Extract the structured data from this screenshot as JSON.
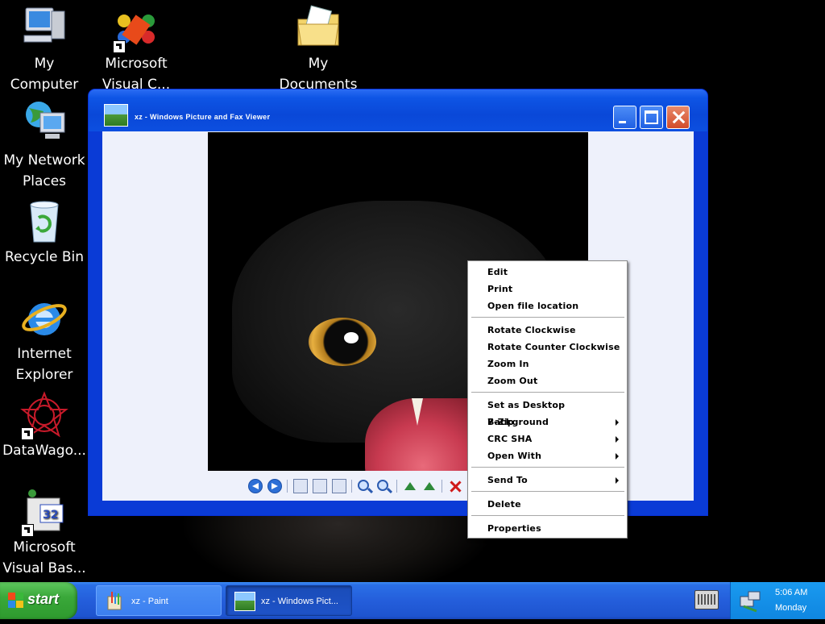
{
  "desktop": {
    "icons": [
      {
        "label_lines": [
          "My",
          "Computer"
        ]
      },
      {
        "label_lines": [
          "Microsoft",
          "Visual C..."
        ]
      },
      {
        "label_lines": [
          "My",
          "Documents"
        ]
      },
      {
        "label_lines": [
          "My Network",
          "Places"
        ]
      },
      {
        "label_lines": [
          "Recycle Bin"
        ]
      },
      {
        "label_lines": [
          "Internet",
          "Explorer"
        ]
      },
      {
        "label_lines": [
          "DataWago..."
        ]
      },
      {
        "label_lines": [
          "Microsoft",
          "Visual Bas..."
        ]
      }
    ]
  },
  "window": {
    "title": "xz - Windows Picture and Fax Viewer"
  },
  "context_menu": {
    "items": [
      {
        "label": "Edit"
      },
      {
        "label": "Print"
      },
      {
        "label": "Open file location"
      },
      {
        "label": "Rotate Clockwise"
      },
      {
        "label": "Rotate Counter Clockwise"
      },
      {
        "label": "Zoom In"
      },
      {
        "label": "Zoom Out"
      },
      {
        "label": "Set as Desktop Background"
      },
      {
        "label": "7-Zip"
      },
      {
        "label": "CRC SHA"
      },
      {
        "label": "Open With"
      },
      {
        "label": "Send To"
      },
      {
        "label": "Delete"
      },
      {
        "label": "Properties"
      }
    ]
  },
  "taskbar": {
    "start_label": "start",
    "tasks": [
      {
        "label": "xz - Paint"
      },
      {
        "label": "xz - Windows Pict..."
      }
    ],
    "clock": {
      "time": "5:06 AM",
      "day": "Monday"
    }
  },
  "colors": {
    "window_frame": "#0a3bd6",
    "taskbar": "#245edb",
    "start_button": "#3aa83a",
    "tray": "#0f86e0"
  }
}
